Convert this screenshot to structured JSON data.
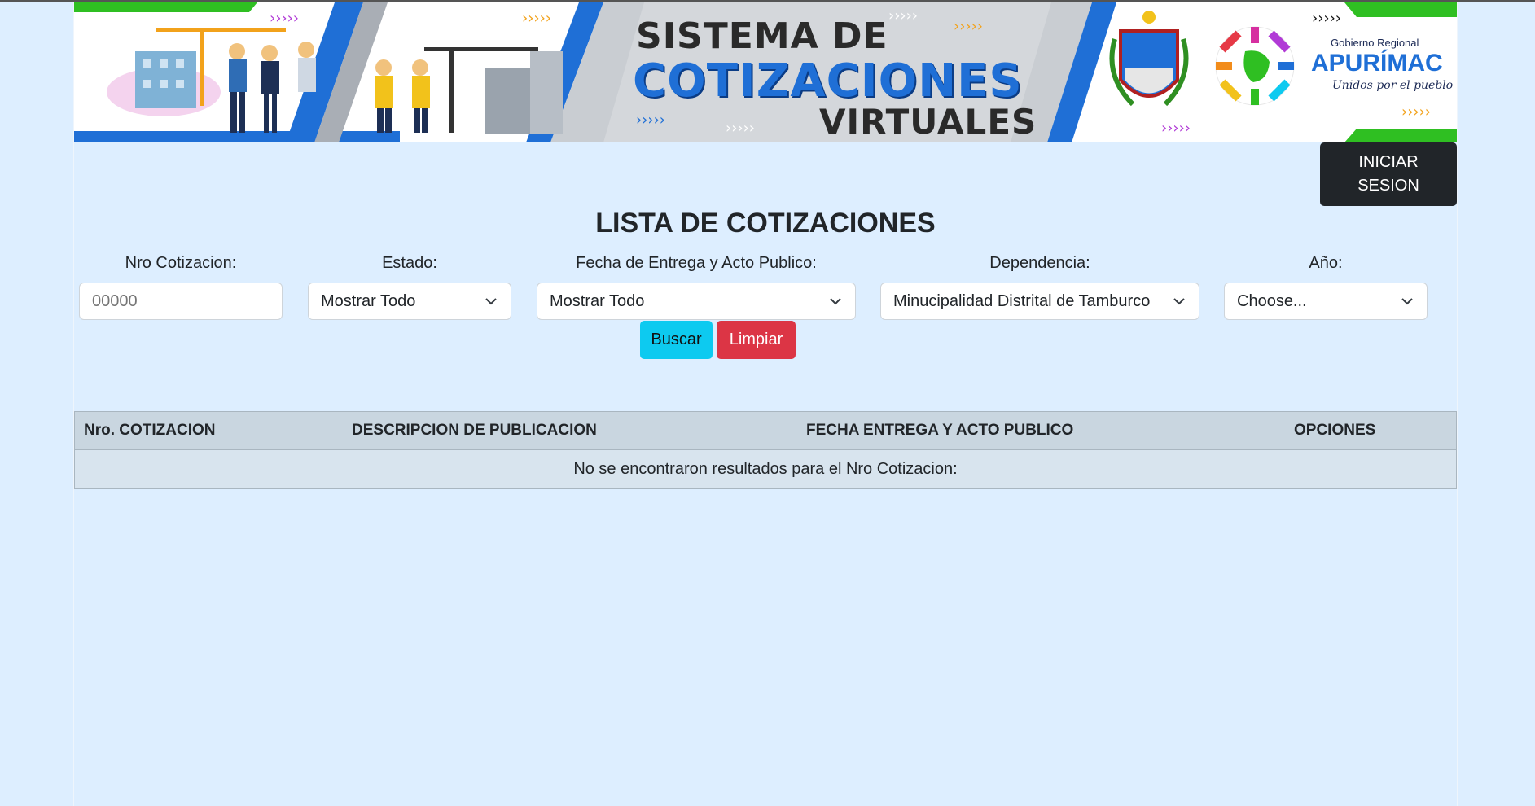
{
  "banner": {
    "title_line1": "SISTEMA DE",
    "title_line2": "COTIZACIONES",
    "title_line3": "VIRTUALES",
    "gobierno_regional": "Gobierno Regional",
    "region_name": "APURÍMAC",
    "slogan": "Unidos por el pueblo",
    "icons": [
      "construction-workers-illustration",
      "crane-illustration",
      "municipal-coat-of-arms",
      "regional-logo"
    ]
  },
  "header": {
    "login_label_line1": "INICIAR",
    "login_label_line2": "SESION"
  },
  "page_title": "LISTA DE COTIZACIONES",
  "filters": {
    "nro_label": "Nro Cotizacion:",
    "nro_placeholder": "00000",
    "estado_label": "Estado:",
    "estado_value": "Mostrar Todo",
    "fecha_label": "Fecha de Entrega y Acto Publico:",
    "fecha_value": "Mostrar Todo",
    "dependencia_label": "Dependencia:",
    "dependencia_value": "Minucipalidad Distrital de Tamburco",
    "anio_label": "Año:",
    "anio_value": "Choose..."
  },
  "actions": {
    "search_label": "Buscar",
    "clear_label": "Limpiar"
  },
  "table": {
    "columns": [
      "Nro. COTIZACION",
      "DESCRIPCION DE PUBLICACION",
      "FECHA ENTREGA Y ACTO PUBLICO",
      "OPCIONES"
    ],
    "empty_message": "No se encontraron resultados para el Nro Cotizacion:"
  },
  "colors": {
    "page_bg": "#ddeeff",
    "login_bg": "#212529",
    "search_btn": "#0dcaf0",
    "clear_btn": "#dc3545",
    "table_header_bg": "#c9d6e0",
    "brand_blue": "#1f6fd6",
    "brand_green": "#2fbf22"
  }
}
